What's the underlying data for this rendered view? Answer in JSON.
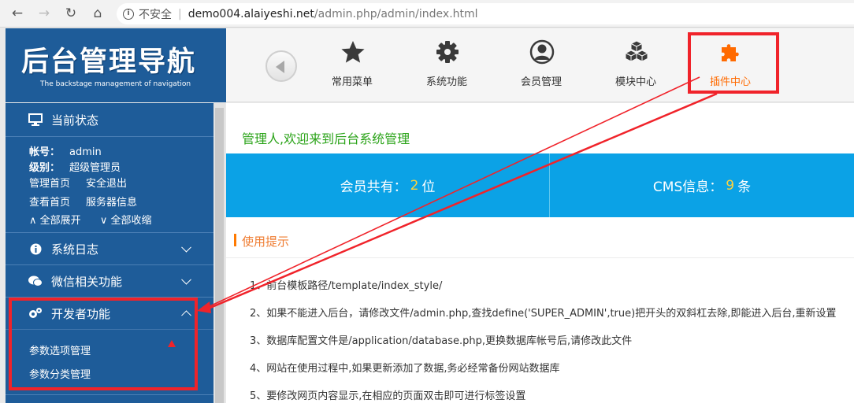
{
  "browser": {
    "back": "←",
    "forward": "→",
    "reload": "↻",
    "home": "⌂",
    "security_label": "不安全",
    "url_host": "demo004.alaiyeshi.net",
    "url_path": "/admin.php/admin/index.html"
  },
  "logo": {
    "title": "后台管理导航",
    "subtitle": "The backstage management of navigation"
  },
  "topnav": {
    "items": [
      {
        "label": "常用菜单",
        "icon": "star-icon"
      },
      {
        "label": "系统功能",
        "icon": "gear-icon"
      },
      {
        "label": "会员管理",
        "icon": "user-icon"
      },
      {
        "label": "模块中心",
        "icon": "cubes-icon"
      },
      {
        "label": "插件中心",
        "icon": "puzzle-icon",
        "active": true
      }
    ]
  },
  "sidebar": {
    "status_title": "当前状态",
    "account_label": "帐号：",
    "account_value": "admin",
    "level_label": "级别：",
    "level_value": "超级管理员",
    "links": [
      "管理首页",
      "安全退出",
      "查看首页",
      "服务器信息"
    ],
    "expand_all": "全部展开",
    "collapse_all": "全部收缩",
    "sections": [
      {
        "label": "系统日志",
        "icon": "info-icon"
      },
      {
        "label": "微信相关功能",
        "icon": "wechat-icon"
      },
      {
        "label": "开发者功能",
        "icon": "gears-icon",
        "expanded": true
      }
    ],
    "dev_items": [
      "参数选项管理",
      "参数分类管理"
    ]
  },
  "main": {
    "welcome": "管理人,欢迎来到后台系统管理",
    "member_prefix": "会员共有：",
    "member_count": "2",
    "member_unit": "位",
    "cms_prefix": "CMS信息：",
    "cms_count": "9",
    "cms_unit": "条",
    "tips_title": "使用提示",
    "tips": [
      "1、前台模板路径/template/index_style/",
      "2、如果不能进入后台，请修改文件/admin.php,查找define('SUPER_ADMIN',true)把开头的双斜杠去除,即能进入后台,重新设置",
      "3、数据库配置文件是/application/database.php,更换数据库帐号后,请修改此文件",
      "4、网站在使用过程中,如果更新添加了数据,务必经常备份网站数据库",
      "5、要修改网页内容显示,在相应的页面双击即可进行标签设置"
    ]
  },
  "colors": {
    "brand": "#1e5c99",
    "accent": "#0ba2e6",
    "active": "#ff6a00",
    "annotation": "#f0232a",
    "welcome": "#2aa318"
  }
}
